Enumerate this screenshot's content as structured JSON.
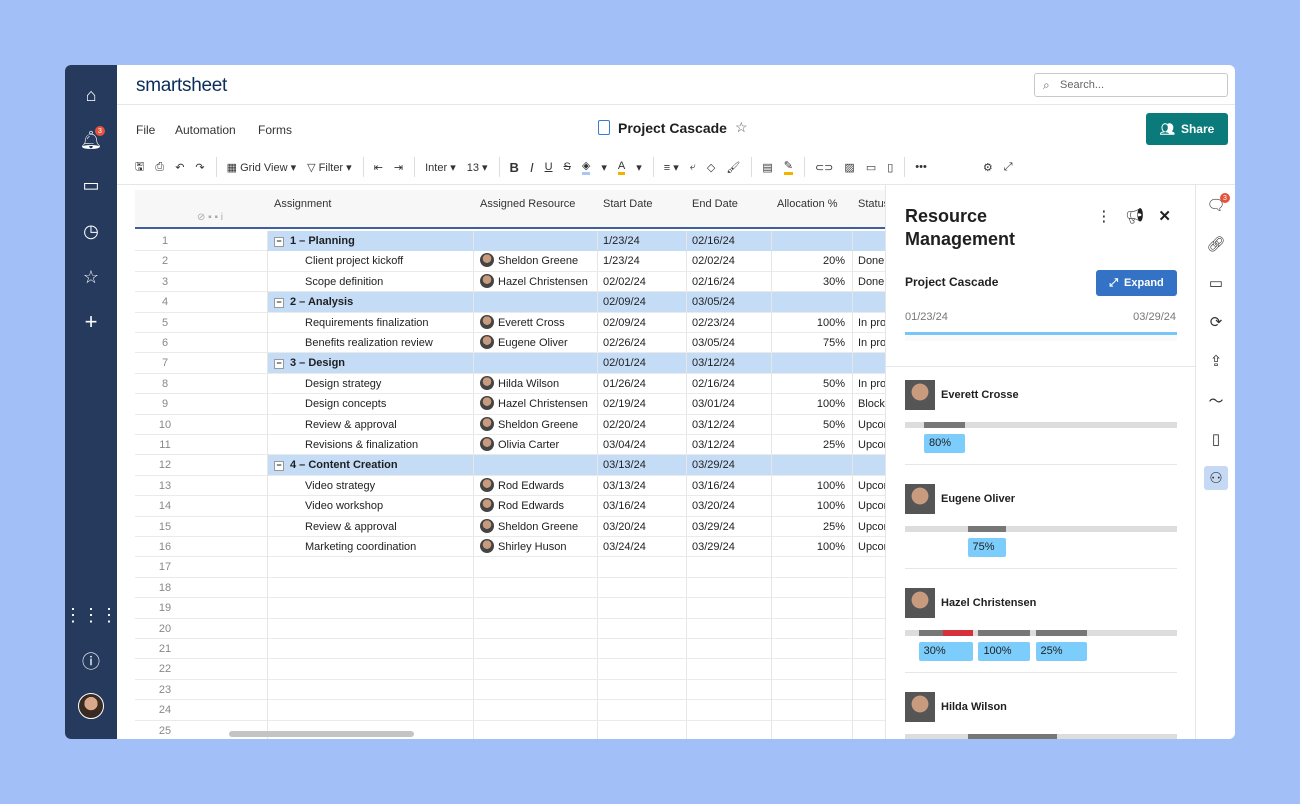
{
  "app": {
    "logo": "smartsheet",
    "search_placeholder": "Search...",
    "share_label": "Share",
    "sheet_title": "Project Cascade",
    "notification_count": "3"
  },
  "menu": [
    "File",
    "Automation",
    "Forms"
  ],
  "toolbar": {
    "view": "Grid View",
    "filter": "Filter",
    "font": "Inter",
    "size": "13"
  },
  "columns": [
    "Assignment",
    "Assigned Resource",
    "Start Date",
    "End Date",
    "Allocation %",
    "Status"
  ],
  "rows": [
    {
      "n": "1",
      "group": true,
      "a": "1 – Planning",
      "r": "",
      "s": "1/23/24",
      "e": "02/16/24",
      "p": "",
      "st": ""
    },
    {
      "n": "2",
      "a": "Client project kickoff",
      "r": "Sheldon Greene",
      "s": "1/23/24",
      "e": "02/02/24",
      "p": "20%",
      "st": "Done"
    },
    {
      "n": "3",
      "a": "Scope definition",
      "r": "Hazel Christensen",
      "s": "02/02/24",
      "e": "02/16/24",
      "p": "30%",
      "st": "Done"
    },
    {
      "n": "4",
      "group": true,
      "a": "2 – Analysis",
      "r": "",
      "s": "02/09/24",
      "e": "03/05/24",
      "p": "",
      "st": ""
    },
    {
      "n": "5",
      "a": "Requirements finalization",
      "r": "Everett Cross",
      "s": "02/09/24",
      "e": "02/23/24",
      "p": "100%",
      "st": "In progress"
    },
    {
      "n": "6",
      "a": "Benefits realization review",
      "r": "Eugene Oliver",
      "s": "02/26/24",
      "e": "03/05/24",
      "p": "75%",
      "st": "In progress"
    },
    {
      "n": "7",
      "group": true,
      "a": "3 – Design",
      "r": "",
      "s": "02/01/24",
      "e": "03/12/24",
      "p": "",
      "st": ""
    },
    {
      "n": "8",
      "a": "Design strategy",
      "r": "Hilda Wilson",
      "s": "01/26/24",
      "e": "02/16/24",
      "p": "50%",
      "st": "In progress"
    },
    {
      "n": "9",
      "a": "Design concepts",
      "r": "Hazel Christensen",
      "s": "02/19/24",
      "e": "03/01/24",
      "p": "100%",
      "st": "Blocked"
    },
    {
      "n": "10",
      "a": "Review & approval",
      "r": "Sheldon Greene",
      "s": "02/20/24",
      "e": "03/12/24",
      "p": "50%",
      "st": "Upcoming"
    },
    {
      "n": "11",
      "a": "Revisions & finalization",
      "r": "Olivia Carter",
      "s": "03/04/24",
      "e": "03/12/24",
      "p": "25%",
      "st": "Upcoming"
    },
    {
      "n": "12",
      "group": true,
      "a": "4 – Content Creation",
      "r": "",
      "s": "03/13/24",
      "e": "03/29/24",
      "p": "",
      "st": ""
    },
    {
      "n": "13",
      "a": "Video strategy",
      "r": "Rod Edwards",
      "s": "03/13/24",
      "e": "03/16/24",
      "p": "100%",
      "st": "Upcoming"
    },
    {
      "n": "14",
      "a": "Video workshop",
      "r": "Rod Edwards",
      "s": "03/16/24",
      "e": "03/20/24",
      "p": "100%",
      "st": "Upcoming"
    },
    {
      "n": "15",
      "a": "Review & approval",
      "r": "Sheldon Greene",
      "s": "03/20/24",
      "e": "03/29/24",
      "p": "25%",
      "st": "Upcoming"
    },
    {
      "n": "16",
      "a": "Marketing coordination",
      "r": "Shirley Huson",
      "s": "03/24/24",
      "e": "03/29/24",
      "p": "100%",
      "st": "Upcoming"
    },
    {
      "n": "17"
    },
    {
      "n": "18"
    },
    {
      "n": "19"
    },
    {
      "n": "20"
    },
    {
      "n": "21"
    },
    {
      "n": "22"
    },
    {
      "n": "23"
    },
    {
      "n": "24"
    },
    {
      "n": "25"
    }
  ],
  "panel": {
    "title": "Resource Management",
    "project": "Project Cascade",
    "expand_label": "Expand",
    "start": "01/23/24",
    "end": "03/29/24",
    "people": [
      {
        "name": "Everett Crosse",
        "allocations": [
          {
            "label": "80%",
            "from": 0.07,
            "to": 0.22
          }
        ]
      },
      {
        "name": "Eugene Oliver",
        "allocations": [
          {
            "label": "75%",
            "from": 0.23,
            "to": 0.37
          }
        ]
      },
      {
        "name": "Hazel Christensen",
        "allocations": [
          {
            "label": "30%",
            "from": 0.05,
            "to": 0.25,
            "overallocated_from": 0.14
          },
          {
            "label": "100%",
            "from": 0.27,
            "to": 0.46
          },
          {
            "label": "25%",
            "from": 0.48,
            "to": 0.67
          }
        ]
      },
      {
        "name": "Hilda Wilson",
        "allocations": [
          {
            "label": "",
            "from": 0.23,
            "to": 0.56
          }
        ]
      }
    ]
  },
  "colors": {
    "nav": "#253a5c",
    "share": "#0a7a7a",
    "group_row": "#c5dcf7",
    "expand": "#3372c4",
    "pill": "#7ccdfc",
    "overallocated": "#d6303c"
  }
}
